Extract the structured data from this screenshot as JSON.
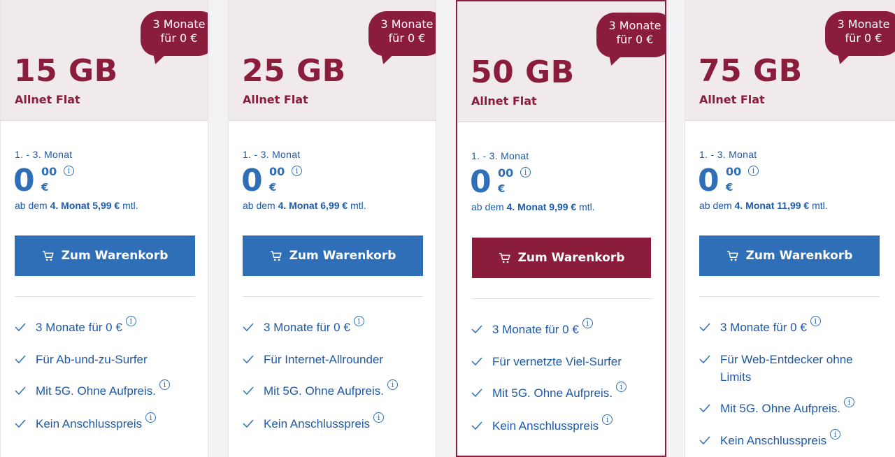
{
  "colors": {
    "brand": "#8a1c3c",
    "primary": "#2e6fb8",
    "header_bg": "#f1eaed"
  },
  "plans": [
    {
      "size": "15 GB",
      "name": "Allnet Flat",
      "promo_line1": "3 Monate",
      "promo_line2": "für 0 €",
      "period": "1. - 3. Monat",
      "price_int": "0",
      "price_cents": "00",
      "currency": "€",
      "after_prefix": "ab dem",
      "after_month": "4. Monat",
      "after_price": "5,99 €",
      "after_suffix": "mtl.",
      "button": "Zum Warenkorb",
      "features": [
        "3 Monate für 0 €",
        "Für Ab-und-zu-Surfer",
        "Mit 5G. Ohne Aufpreis.",
        "Kein Anschlusspreis"
      ]
    },
    {
      "size": "25 GB",
      "name": "Allnet Flat",
      "promo_line1": "3 Monate",
      "promo_line2": "für 0 €",
      "period": "1. - 3. Monat",
      "price_int": "0",
      "price_cents": "00",
      "currency": "€",
      "after_prefix": "ab dem",
      "after_month": "4. Monat",
      "after_price": "6,99 €",
      "after_suffix": "mtl.",
      "button": "Zum Warenkorb",
      "features": [
        "3 Monate für 0 €",
        "Für Internet-Allrounder",
        "Mit 5G. Ohne Aufpreis.",
        "Kein Anschlusspreis"
      ]
    },
    {
      "size": "50 GB",
      "name": "Allnet Flat",
      "promo_line1": "3 Monate",
      "promo_line2": "für 0 €",
      "period": "1. - 3. Monat",
      "price_int": "0",
      "price_cents": "00",
      "currency": "€",
      "after_prefix": "ab dem",
      "after_month": "4. Monat",
      "after_price": "9,99 €",
      "after_suffix": "mtl.",
      "button": "Zum Warenkorb",
      "features": [
        "3 Monate für 0 €",
        "Für vernetzte Viel-Surfer",
        "Mit 5G. Ohne Aufpreis.",
        "Kein Anschlusspreis"
      ]
    },
    {
      "size": "75 GB",
      "name": "Allnet Flat",
      "promo_line1": "3 Monate",
      "promo_line2": "für 0 €",
      "period": "1. - 3. Monat",
      "price_int": "0",
      "price_cents": "00",
      "currency": "€",
      "after_prefix": "ab dem",
      "after_month": "4. Monat",
      "after_price": "11,99 €",
      "after_suffix": "mtl.",
      "button": "Zum Warenkorb",
      "features": [
        "3 Monate für 0 €",
        "Für Web-Entdecker ohne Limits",
        "Mit 5G. Ohne Aufpreis.",
        "Kein Anschlusspreis"
      ]
    }
  ],
  "icons": {
    "info": "i",
    "check": "check-icon",
    "cart": "cart-icon"
  }
}
